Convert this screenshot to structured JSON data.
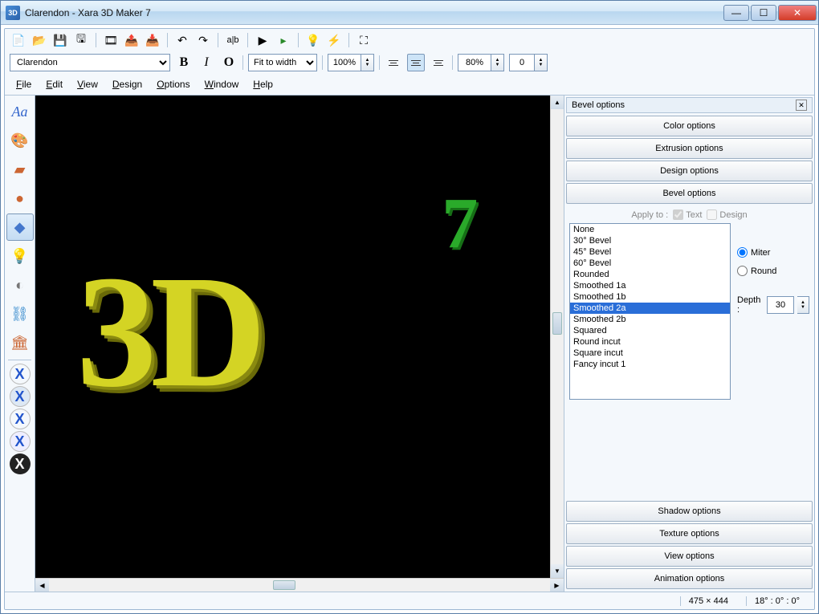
{
  "title": "Clarendon - Xara 3D Maker 7",
  "title_icon": "3D",
  "toolbar2": {
    "font": "Clarendon",
    "bold": "B",
    "italic": "I",
    "outline": "O",
    "fit": "Fit to width",
    "zoom": "100%",
    "tracking": "80%",
    "baseline": "0"
  },
  "menu": {
    "file": "File",
    "edit": "Edit",
    "view": "View",
    "design": "Design",
    "options": "Options",
    "window": "Window",
    "help": "Help"
  },
  "canvas": {
    "main": "3D",
    "sup": "7"
  },
  "panel": {
    "header": "Bevel options",
    "buttons": {
      "color": "Color options",
      "extrusion": "Extrusion options",
      "design": "Design options",
      "bevel": "Bevel options",
      "shadow": "Shadow options",
      "texture": "Texture options",
      "view": "View options",
      "animation": "Animation options"
    },
    "apply_label": "Apply to :",
    "apply_text": "Text",
    "apply_design": "Design",
    "bevel_list": [
      "None",
      "30° Bevel",
      "45° Bevel",
      "60° Bevel",
      "Rounded",
      "Smoothed 1a",
      "Smoothed 1b",
      "Smoothed 2a",
      "Smoothed 2b",
      "Squared",
      "Round incut",
      "Square incut",
      "Fancy incut 1"
    ],
    "selected_bevel": "Smoothed 2a",
    "miter": "Miter",
    "round": "Round",
    "depth_label": "Depth :",
    "depth": "30"
  },
  "status": {
    "size": "475 × 444",
    "angles": "18° : 0° : 0°"
  }
}
